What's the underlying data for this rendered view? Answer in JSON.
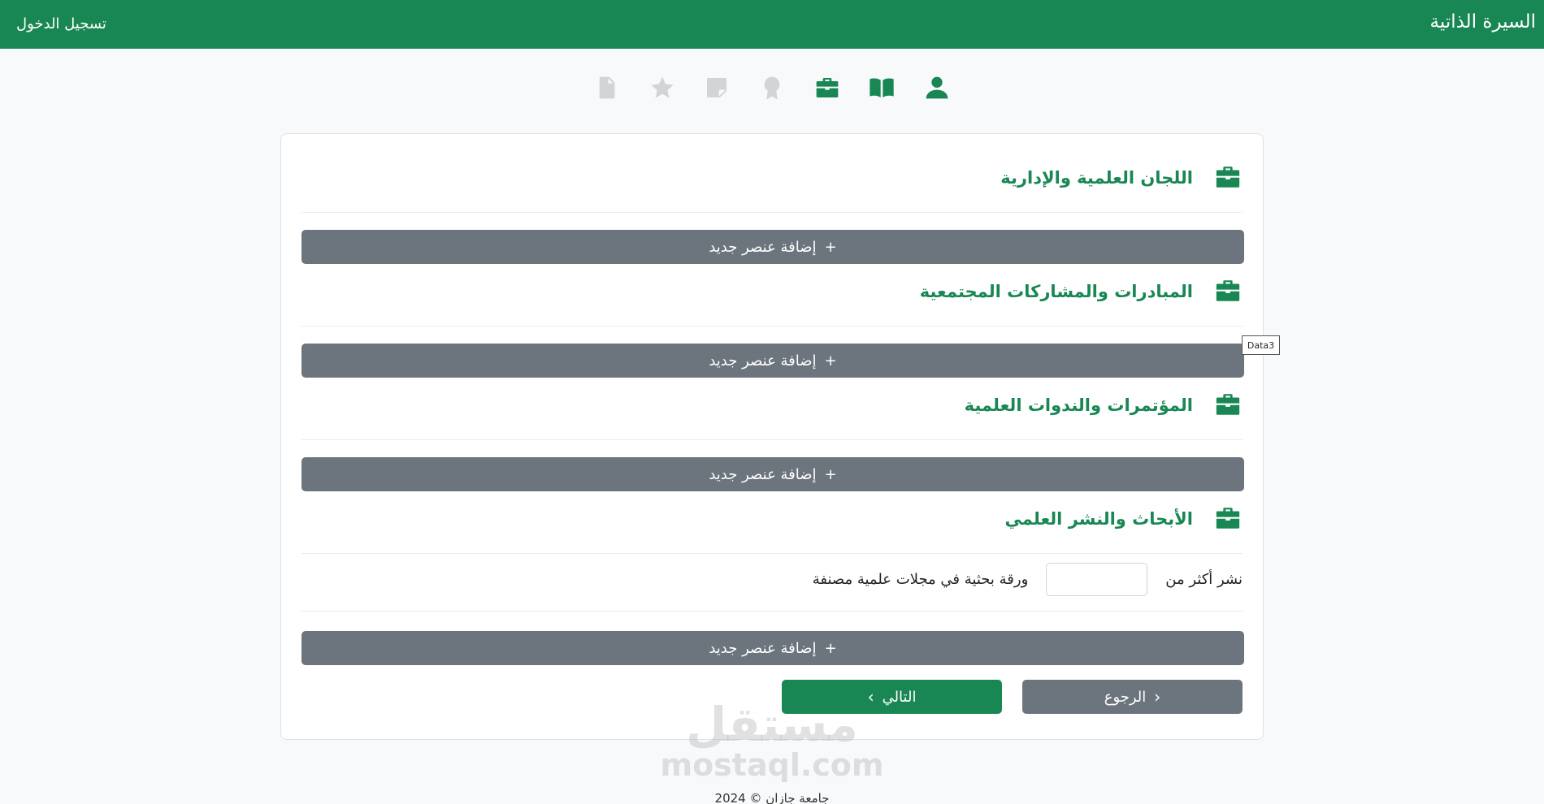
{
  "navbar": {
    "brand": "السيرة الذاتية",
    "login": "تسجيل الدخول",
    "color": "#198754"
  },
  "steps": [
    {
      "icon": "user-icon",
      "state": "active"
    },
    {
      "icon": "book-icon",
      "state": "active"
    },
    {
      "icon": "briefcase-icon",
      "state": "active"
    },
    {
      "icon": "award-icon",
      "state": "inactive"
    },
    {
      "icon": "sticky-note-icon",
      "state": "inactive"
    },
    {
      "icon": "star-icon",
      "state": "inactive"
    },
    {
      "icon": "document-icon",
      "state": "inactive"
    }
  ],
  "sections": [
    {
      "title": "اللجان العلمية والإدارية",
      "icon": "briefcase-icon",
      "add_label": "إضافة عنصر جديد"
    },
    {
      "title": "المبادرات والمشاركات المجتمعية",
      "icon": "briefcase-icon",
      "add_label": "إضافة عنصر جديد"
    },
    {
      "title": "المؤتمرات والندوات العلمية",
      "icon": "briefcase-icon",
      "add_label": "إضافة عنصر جديد"
    },
    {
      "title": "الأبحاث والنشر العلمي",
      "icon": "briefcase-icon",
      "add_label": "إضافة عنصر جديد"
    }
  ],
  "publication": {
    "prefix": "نشر أكثر من",
    "value": "",
    "suffix": "ورقة بحثية في مجلات علمية مصنفة"
  },
  "tooltip": "Data3",
  "buttons": {
    "back": "الرجوع",
    "next": "التالي",
    "add_plus": "+"
  },
  "watermark": {
    "arabic": "مستقل",
    "latin": "mostaql.com"
  },
  "footer": "جامعة جازان © 2024"
}
